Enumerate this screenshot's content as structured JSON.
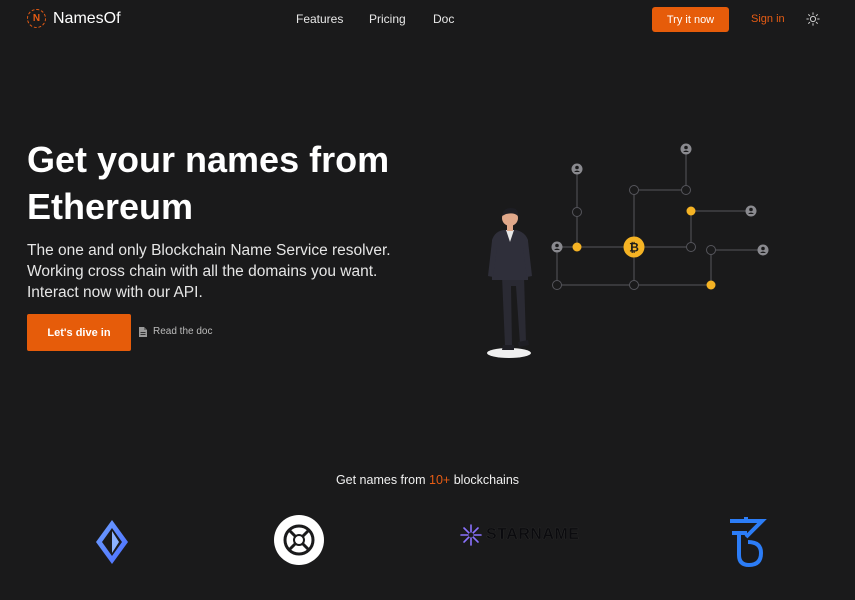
{
  "brand": {
    "name": "NamesOf",
    "logo_letter": "N"
  },
  "nav": {
    "items": [
      {
        "label": "Features"
      },
      {
        "label": "Pricing"
      },
      {
        "label": "Doc"
      }
    ]
  },
  "header_actions": {
    "try_label": "Try it now",
    "signin_label": "Sign in",
    "theme_icon": "sun-icon"
  },
  "hero": {
    "title_line1": "Get your names from",
    "title_line2": "Ethereum",
    "subtitle_line1": "The one and only Blockchain Name Service resolver.",
    "subtitle_line2": "Working cross chain with all the domains you want.",
    "subtitle_line3": "Interact now with our API.",
    "cta_label": "Let's dive in",
    "doc_link_label": "Read the doc"
  },
  "chains": {
    "heading_prefix": "Get names from ",
    "heading_accent": "10+",
    "heading_suffix": " blockchains",
    "logos": [
      {
        "icon": "ens-icon"
      },
      {
        "icon": "elrond-icon"
      },
      {
        "icon": "starname-icon",
        "label": "STARNAME"
      },
      {
        "icon": "tezos-icon"
      }
    ]
  },
  "colors": {
    "background": "#1a1a1b",
    "accent": "#e65c0a",
    "node_yellow": "#f5b324",
    "line_grey": "#55555b"
  }
}
